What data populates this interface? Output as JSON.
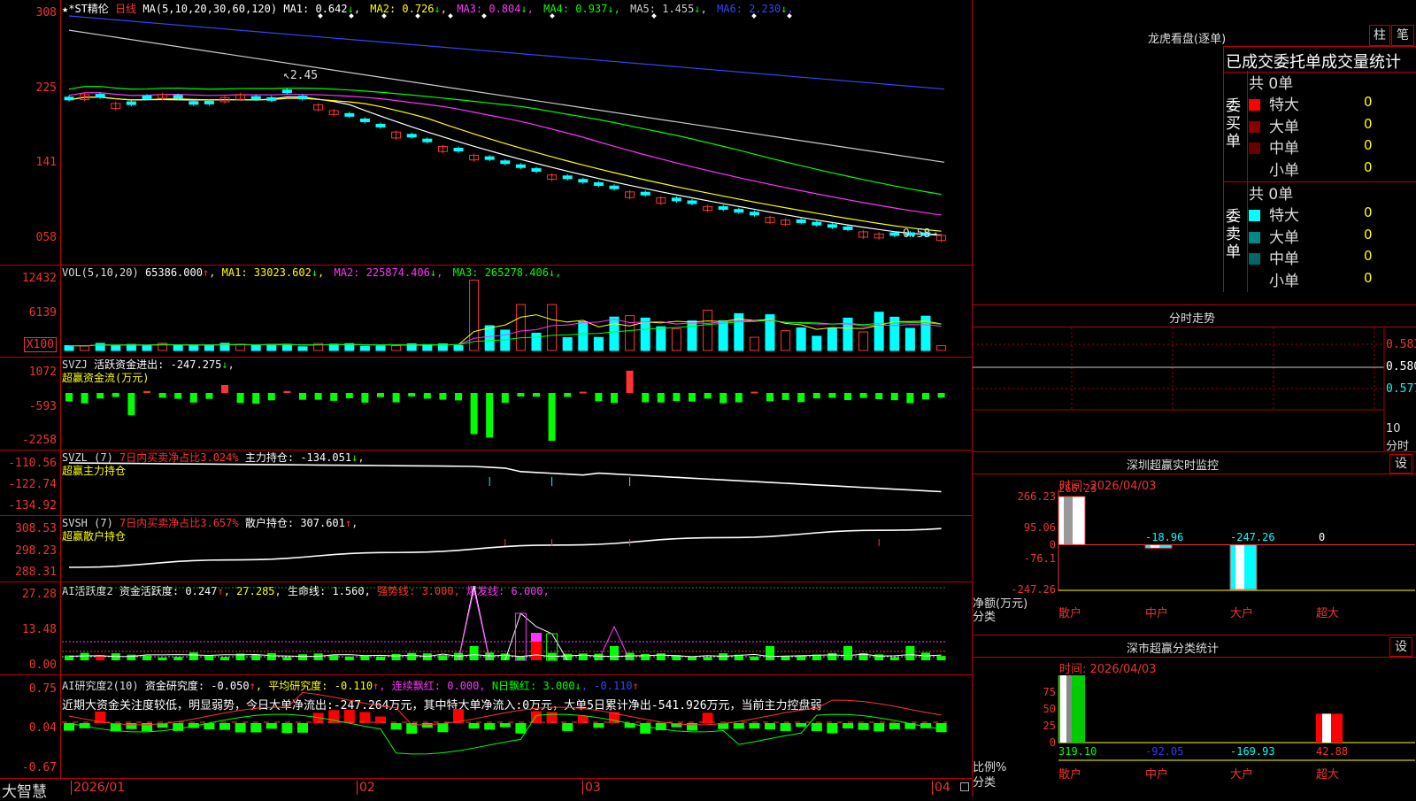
{
  "main": {
    "title": "★*ST精伦",
    "period": "日线",
    "ma_label": "MA(5,10,20,30,60,120)",
    "ma_items": [
      {
        "label": "MA1:",
        "value": "0.642",
        "arrow": "↓",
        "color": "#ffffff"
      },
      {
        "label": "MA2:",
        "value": "0.726",
        "arrow": "↓",
        "color": "#ffff00"
      },
      {
        "label": "MA3:",
        "value": "0.804",
        "arrow": "↓",
        "color": "#ff33ff"
      },
      {
        "label": "MA4:",
        "value": "0.937",
        "arrow": "↓",
        "color": "#00ff00"
      },
      {
        "label": "MA5:",
        "value": "1.455",
        "arrow": "↓",
        "color": "#cccccc"
      },
      {
        "label": "MA6:",
        "value": "2.230",
        "arrow": "↓",
        "color": "#3344ff"
      }
    ],
    "y_labels": [
      "308",
      "225",
      "141",
      "058"
    ],
    "high_label": "2.45",
    "low_label": "0.58"
  },
  "vol": {
    "label": "VOL(5,10,20)",
    "value": "65386.000",
    "value_arrow": "↑",
    "items": [
      {
        "label": "MA1:",
        "value": "33023.602",
        "arrow": "↓",
        "color": "#ffff00"
      },
      {
        "label": "MA2:",
        "value": "225874.406",
        "arrow": "↓",
        "color": "#ff33ff"
      },
      {
        "label": "MA3:",
        "value": "265278.406",
        "arrow": "↓",
        "color": "#00ff00"
      }
    ],
    "y_labels": [
      "12432",
      "6139"
    ],
    "unit": "X100"
  },
  "svzj": {
    "label": "SVZJ",
    "item": "活跃资金进出:",
    "value": "-247.275",
    "arrow": "↓",
    "sub": "超赢资金流(万元)",
    "y_labels": [
      "1072",
      "-593",
      "-2258"
    ]
  },
  "svzl": {
    "label": "SVZL (7)",
    "item1": "7日内买卖净占比3.024%",
    "item2": "主力持仓:",
    "value": "-134.051",
    "arrow": "↓",
    "sub": "超赢主力持仓",
    "y_labels": [
      "-110.56",
      "-122.74",
      "-134.92"
    ]
  },
  "svsh": {
    "label": "SVSH (7)",
    "item1": "7日内买卖净占比3.657%",
    "item2": "散户持仓:",
    "value": "307.601",
    "arrow": "↑",
    "sub": "超赢散户持仓",
    "y_labels": [
      "308.53",
      "298.23",
      "288.31"
    ]
  },
  "ai1": {
    "label": "AI活跃度2",
    "items": [
      {
        "text": "资金活跃度: 0.247",
        "color": "#ffffff"
      },
      {
        "text": "↑",
        "color": "#ff3333"
      },
      {
        "text": ", 27.285,",
        "color": "#ffff00"
      },
      {
        "text": " 生命线: 1.560,",
        "color": "#ffffff"
      },
      {
        "text": " 强势线: 3.000,",
        "color": "#ff3333"
      },
      {
        "text": " 爆发线: 6.000,",
        "color": "#ff33ff"
      }
    ],
    "y_labels": [
      "27.28",
      "13.48",
      "0.00"
    ]
  },
  "ai2": {
    "label": "AI研究度2(10)",
    "items": [
      {
        "text": "资金研究度: -0.050",
        "color": "#ffffff"
      },
      {
        "text": "↑",
        "color": "#ff3333"
      },
      {
        "text": ", 平均研究度: -0.110",
        "color": "#ffff00"
      },
      {
        "text": "↑",
        "color": "#ff3333"
      },
      {
        "text": ", 连续飘红: 0.000,",
        "color": "#ff33ff"
      },
      {
        "text": " N日飘红: 3.000",
        "color": "#00ff00"
      },
      {
        "text": "↓",
        "color": "#00ff00"
      },
      {
        "text": ", -0.110",
        "color": "#3344ff"
      },
      {
        "text": "↑",
        "color": "#ff3333"
      }
    ],
    "comment": "近期大资金关注度较低，明显弱势，今日大单净流出:-247.264万元，其中特大单净流入:0万元，大单5日累计净出-541.926万元，当前主力控盘弱",
    "y_labels": [
      "0.75",
      "0.04",
      "-0.67"
    ]
  },
  "xaxis": {
    "brand": "大智慧",
    "labels": [
      "2026/01",
      "02",
      "03",
      "04"
    ]
  },
  "lhb": {
    "title": "龙虎看盘(逐单)",
    "btn1": "柱",
    "btn2": "笔",
    "tabs_text": "已成交委托单成交量统计",
    "buy_label": "委买单",
    "sell_label": "委卖单",
    "buy_total": "共 0单",
    "sell_total": "共 0单",
    "buy_rows": [
      {
        "name": "特大",
        "value": "0",
        "color": "#ff0000"
      },
      {
        "name": "大单",
        "value": "0",
        "color": "#880000"
      },
      {
        "name": "中单",
        "value": "0",
        "color": "#660000"
      },
      {
        "name": "小单",
        "value": "0",
        "color": "#000000"
      }
    ],
    "sell_rows": [
      {
        "name": "特大",
        "value": "0",
        "color": "#00ffff"
      },
      {
        "name": "大单",
        "value": "0",
        "color": "#008888"
      },
      {
        "name": "中单",
        "value": "0",
        "color": "#006666"
      },
      {
        "name": "小单",
        "value": "0",
        "color": "#000000"
      }
    ]
  },
  "fenshi": {
    "title": "分时走势",
    "y_labels": [
      "0.583",
      "0.580",
      "0.577"
    ],
    "corner": "10",
    "corner2": "分时"
  },
  "sz_monitor": {
    "title": "深圳超赢实时监控",
    "btn": "设",
    "time": "时间: 2026/04/03",
    "y_labels": [
      "266.23",
      "95.06",
      "0",
      "-76.1",
      "-247.26"
    ],
    "ylabel1": "净额(万元)",
    "ylabel2": "分类",
    "categories": [
      "散户",
      "中户",
      "大户",
      "超大"
    ],
    "values": [
      266.23,
      -18.96,
      -247.26,
      0
    ],
    "value_labels": [
      "266.23",
      "-18.96",
      "-247.26",
      "0"
    ]
  },
  "sz_stats": {
    "title": "深市超赢分类统计",
    "btn": "设",
    "time": "时间: 2026/04/03",
    "y_labels": [
      "75",
      "50",
      "25",
      "0"
    ],
    "ylabel1": "比例%",
    "ylabel2": "分类",
    "categories": [
      "散户",
      "中户",
      "大户",
      "超大"
    ],
    "value_labels": [
      "319.10",
      "-92.05",
      "-169.93",
      "42.88"
    ],
    "bars": [
      100,
      0,
      0,
      42.88
    ]
  },
  "colors": {
    "up": "#ff3333",
    "down": "#00ffff",
    "grid": "#aa0000"
  }
}
